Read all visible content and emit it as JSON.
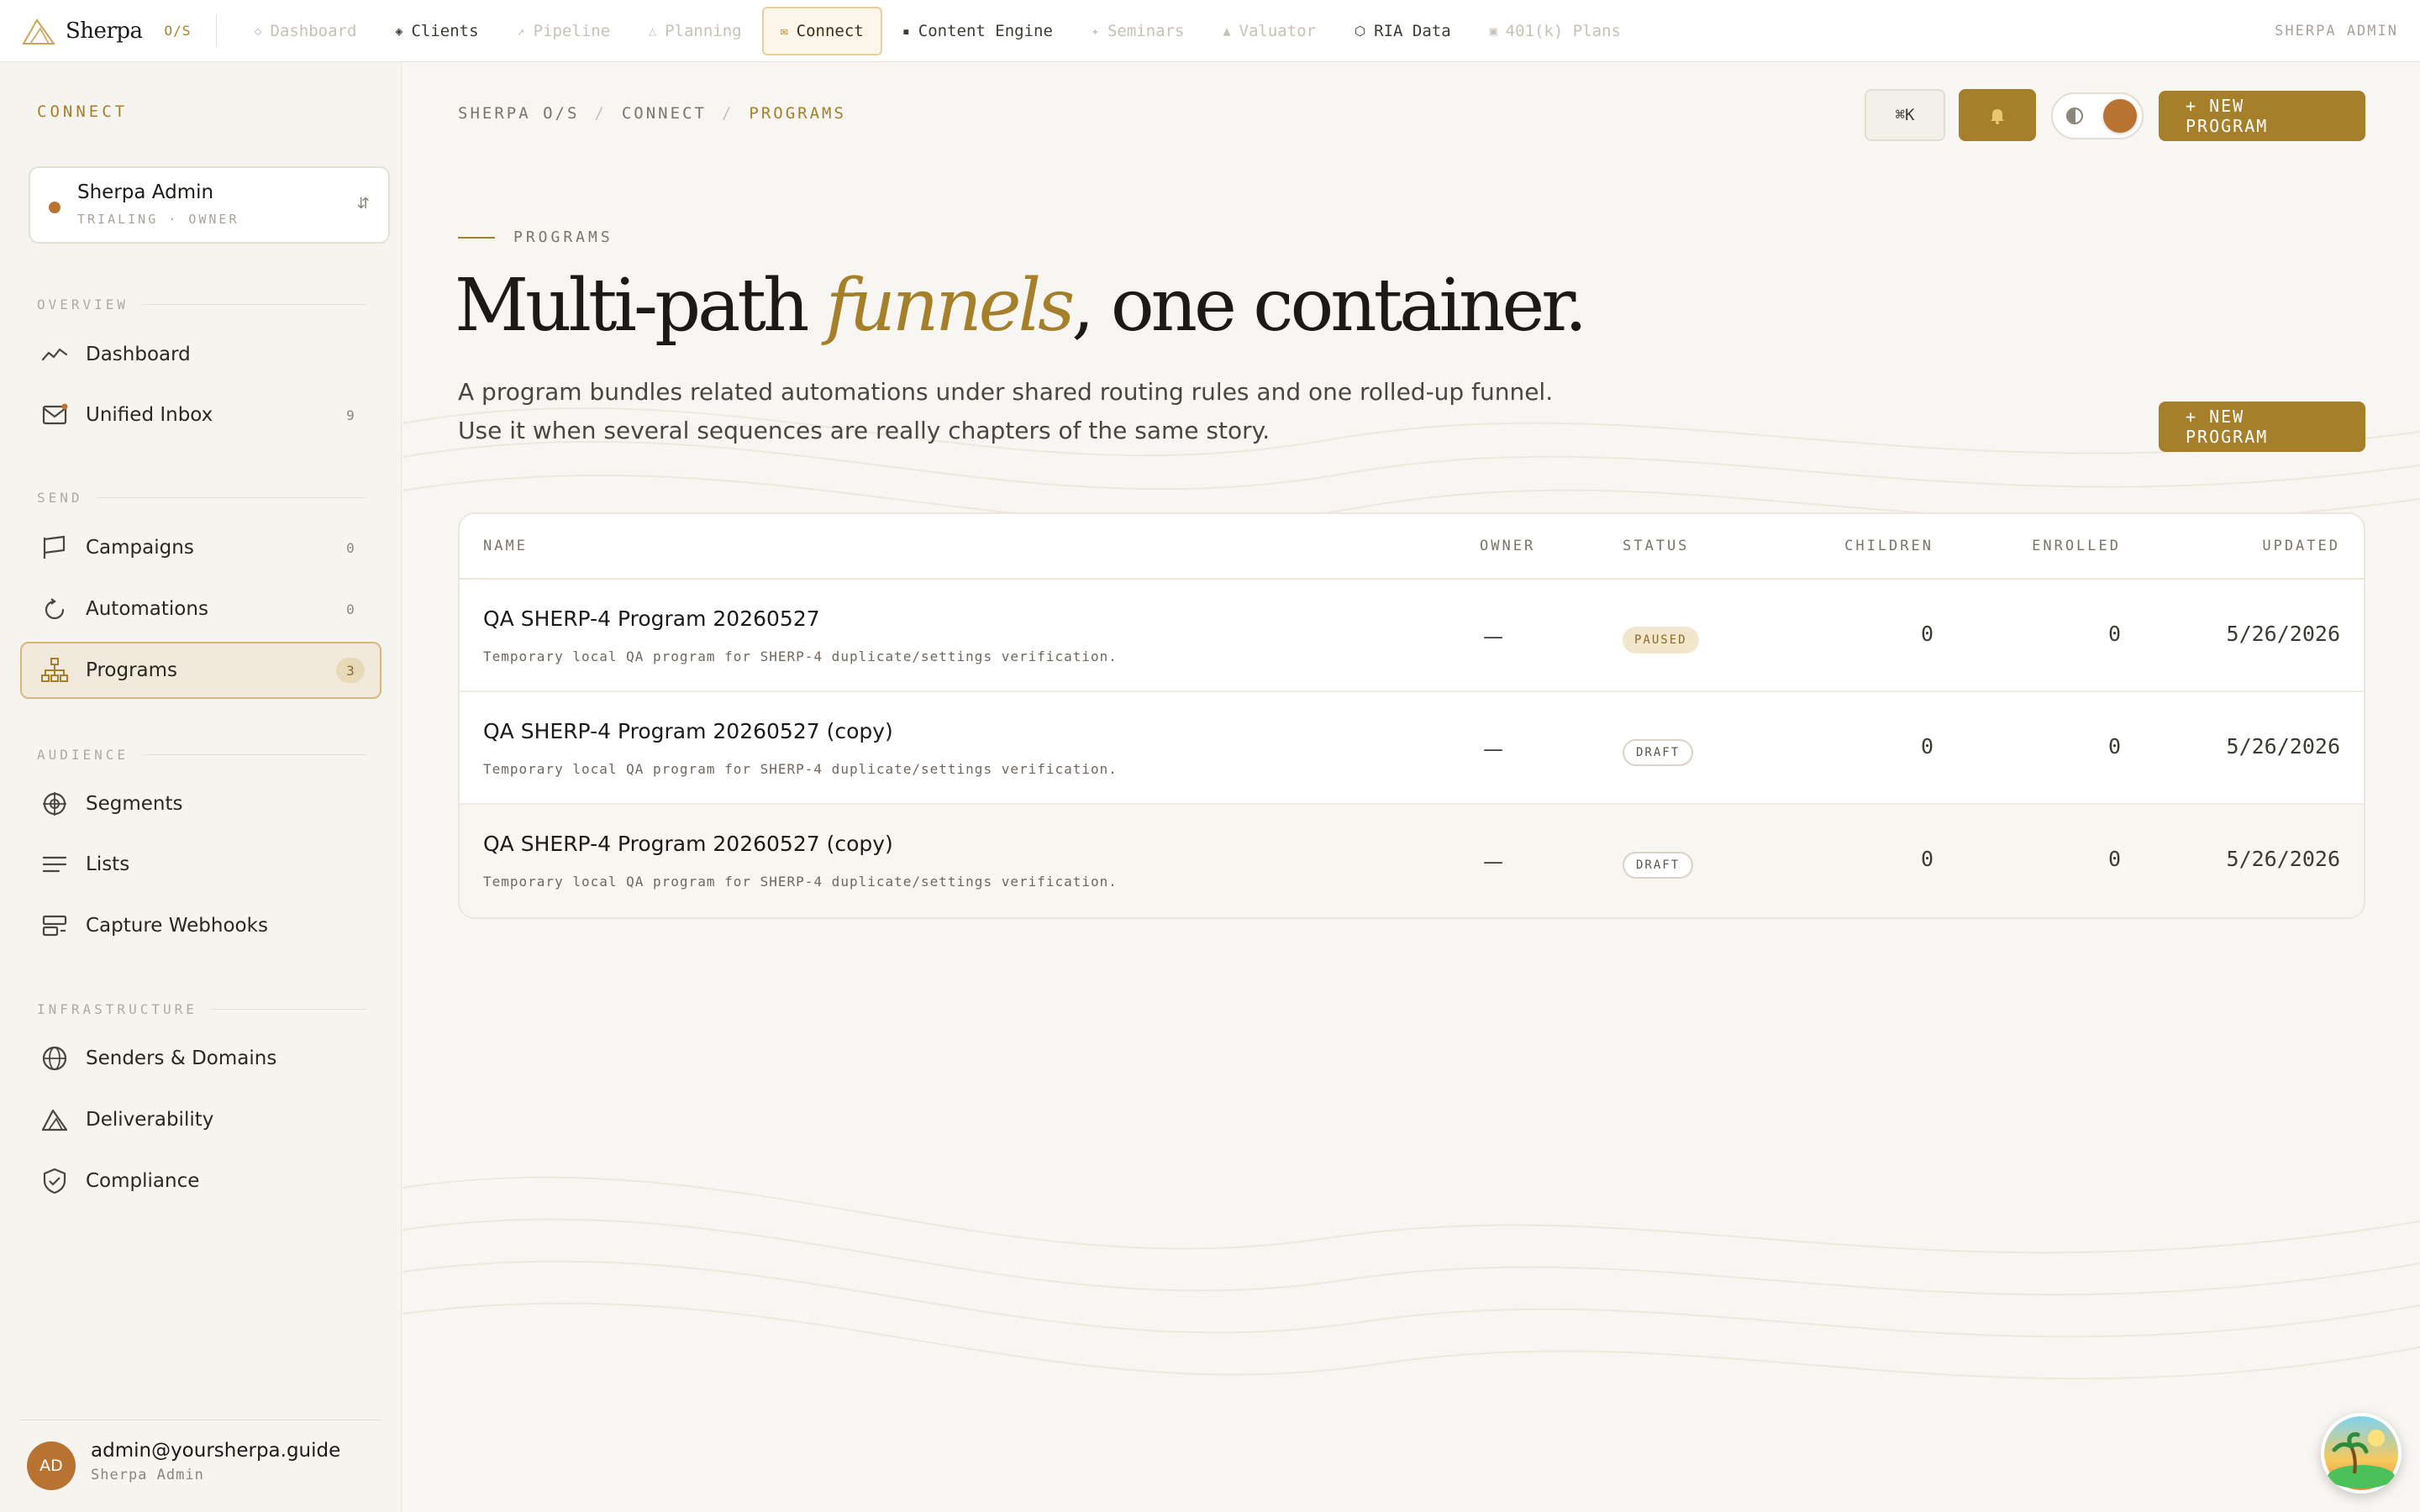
{
  "topnav": {
    "brand": "Sherpa",
    "os_label": "O/S",
    "tabs": [
      {
        "label": "Dashboard",
        "icon": "diamond-outline-icon",
        "glyph": "◇",
        "state": "disabled"
      },
      {
        "label": "Clients",
        "icon": "diamond-filled-icon",
        "glyph": "◈",
        "state": "enabled"
      },
      {
        "label": "Pipeline",
        "icon": "arrow-up-right-icon",
        "glyph": "↗",
        "state": "disabled"
      },
      {
        "label": "Planning",
        "icon": "triangle-icon",
        "glyph": "△",
        "state": "disabled"
      },
      {
        "label": "Connect",
        "icon": "mail-icon",
        "glyph": "✉",
        "state": "active"
      },
      {
        "label": "Content Engine",
        "icon": "square-icon",
        "glyph": "▪",
        "state": "enabled"
      },
      {
        "label": "Seminars",
        "icon": "sparkle-icon",
        "glyph": "✦",
        "state": "disabled"
      },
      {
        "label": "Valuator",
        "icon": "mountain-icon",
        "glyph": "▲",
        "state": "disabled"
      },
      {
        "label": "RIA Data",
        "icon": "hexagon-icon",
        "glyph": "⬡",
        "state": "enabled"
      },
      {
        "label": "401(k) Plans",
        "icon": "grid-square-icon",
        "glyph": "▣",
        "state": "disabled"
      }
    ],
    "right_label": "SHERPA ADMIN"
  },
  "sidebar": {
    "section_title": "CONNECT",
    "account": {
      "name": "Sherpa Admin",
      "sub": "TRIALING · OWNER",
      "swap_glyph": "⇵"
    },
    "groups": [
      {
        "label": "OVERVIEW",
        "items": [
          {
            "label": "Dashboard",
            "icon": "activity-chart-icon",
            "count": ""
          },
          {
            "label": "Unified Inbox",
            "icon": "inbox-mail-icon",
            "count": "9"
          }
        ]
      },
      {
        "label": "SEND",
        "items": [
          {
            "label": "Campaigns",
            "icon": "flag-icon",
            "count": "0"
          },
          {
            "label": "Automations",
            "icon": "refresh-arc-icon",
            "count": "0"
          },
          {
            "label": "Programs",
            "icon": "hierarchy-icon",
            "count": "3"
          }
        ]
      },
      {
        "label": "AUDIENCE",
        "items": [
          {
            "label": "Segments",
            "icon": "crosshair-icon",
            "count": ""
          },
          {
            "label": "Lists",
            "icon": "list-lines-icon",
            "count": ""
          },
          {
            "label": "Capture Webhooks",
            "icon": "server-icon",
            "count": ""
          }
        ]
      },
      {
        "label": "INFRASTRUCTURE",
        "items": [
          {
            "label": "Senders & Domains",
            "icon": "globe-icon",
            "count": ""
          },
          {
            "label": "Deliverability",
            "icon": "mountain-outline-icon",
            "count": ""
          },
          {
            "label": "Compliance",
            "icon": "shield-check-icon",
            "count": ""
          }
        ]
      }
    ],
    "active_item": "Programs",
    "user": {
      "initials": "AD",
      "email": "admin@yoursherpa.guide",
      "role": "Sherpa Admin"
    }
  },
  "main": {
    "breadcrumb": [
      "SHERPA O/S",
      "CONNECT",
      "PROGRAMS"
    ],
    "breadcrumb_sep": "/",
    "shortcut_label": "⌘K",
    "bell_glyph": "🔔",
    "new_program_label": "+ NEW PROGRAM",
    "eyebrow": "PROGRAMS",
    "headline": {
      "pre": "Multi-path ",
      "accent": "funnels",
      "post": ", one container."
    },
    "subtext_1": "A program bundles related automations under shared routing rules and one rolled-up funnel.",
    "subtext_2": "Use it when several sequences are really chapters of the same story.",
    "table": {
      "columns": [
        "NAME",
        "OWNER",
        "STATUS",
        "CHILDREN",
        "ENROLLED",
        "UPDATED"
      ],
      "rows": [
        {
          "name": "QA SHERP-4 Program 20260527",
          "desc": "Temporary local QA program for SHERP-4 duplicate/settings verification.",
          "owner": "—",
          "status": "PAUSED",
          "children": "0",
          "enrolled": "0",
          "updated": "5/26/2026"
        },
        {
          "name": "QA SHERP-4 Program 20260527 (copy)",
          "desc": "Temporary local QA program for SHERP-4 duplicate/settings verification.",
          "owner": "—",
          "status": "DRAFT",
          "children": "0",
          "enrolled": "0",
          "updated": "5/26/2026"
        },
        {
          "name": "QA SHERP-4 Program 20260527 (copy)",
          "desc": "Temporary local QA program for SHERP-4 duplicate/settings verification.",
          "owner": "—",
          "status": "DRAFT",
          "children": "0",
          "enrolled": "0",
          "updated": "5/26/2026"
        }
      ]
    }
  },
  "colors": {
    "accent": "#a67f2b",
    "accent_copper": "#b87333",
    "background": "#f8f6f2",
    "text": "#1c1a17"
  }
}
